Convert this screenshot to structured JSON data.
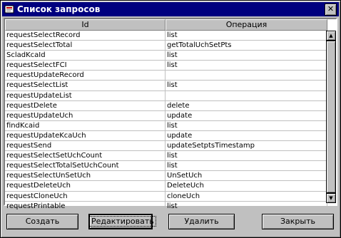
{
  "window": {
    "title": "Список запросов"
  },
  "table": {
    "headers": [
      "Id",
      "Операция"
    ],
    "rows": [
      [
        "requestSelectRecord",
        "list"
      ],
      [
        "requestSelectTotal",
        "getTotalUchSetPts"
      ],
      [
        "ScladKcaId",
        "list"
      ],
      [
        "requestSelectFCI",
        "list"
      ],
      [
        "requestUpdateRecord",
        ""
      ],
      [
        "requestSelectList",
        "list"
      ],
      [
        "requestUpdateList",
        ""
      ],
      [
        "requestDelete",
        "delete"
      ],
      [
        "requestUpdateUch",
        "update"
      ],
      [
        "findKcaid",
        "list"
      ],
      [
        "requestUpdateKcaUch",
        "update"
      ],
      [
        "requestSend",
        "updateSetptsTimestamp"
      ],
      [
        "requestSelectSetUchCount",
        "list"
      ],
      [
        "requestSelectTotalSetUchCount",
        "list"
      ],
      [
        "requestSelectUnSetUch",
        "UnSetUch"
      ],
      [
        "requestDeleteUch",
        "DeleteUch"
      ],
      [
        "requestCloneUch",
        "cloneUch"
      ],
      [
        "requestPrintable",
        "list"
      ]
    ]
  },
  "buttons": {
    "create": "Создать",
    "edit": "Редактировать",
    "delete": "Удалить",
    "close": "Закрыть"
  },
  "icons": {
    "close": "close-icon",
    "app": "app-icon",
    "scroll_up": "arrow-up-icon",
    "scroll_down": "arrow-down-icon"
  }
}
